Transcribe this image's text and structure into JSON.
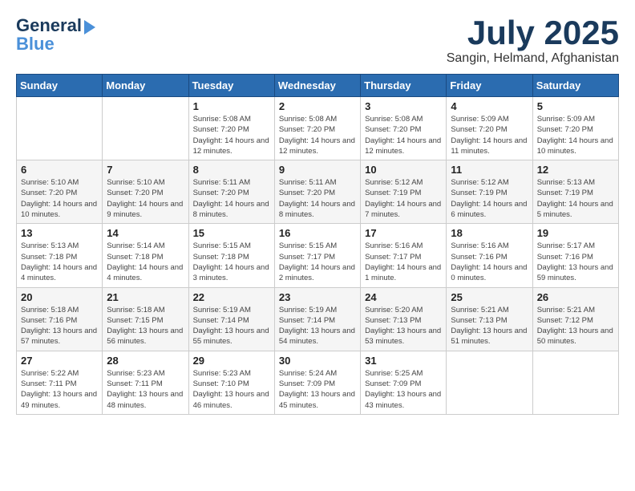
{
  "header": {
    "logo_line1": "General",
    "logo_line2": "Blue",
    "month": "July 2025",
    "location": "Sangin, Helmand, Afghanistan"
  },
  "weekdays": [
    "Sunday",
    "Monday",
    "Tuesday",
    "Wednesday",
    "Thursday",
    "Friday",
    "Saturday"
  ],
  "weeks": [
    [
      {
        "day": "",
        "info": ""
      },
      {
        "day": "",
        "info": ""
      },
      {
        "day": "1",
        "info": "Sunrise: 5:08 AM\nSunset: 7:20 PM\nDaylight: 14 hours\nand 12 minutes."
      },
      {
        "day": "2",
        "info": "Sunrise: 5:08 AM\nSunset: 7:20 PM\nDaylight: 14 hours\nand 12 minutes."
      },
      {
        "day": "3",
        "info": "Sunrise: 5:08 AM\nSunset: 7:20 PM\nDaylight: 14 hours\nand 12 minutes."
      },
      {
        "day": "4",
        "info": "Sunrise: 5:09 AM\nSunset: 7:20 PM\nDaylight: 14 hours\nand 11 minutes."
      },
      {
        "day": "5",
        "info": "Sunrise: 5:09 AM\nSunset: 7:20 PM\nDaylight: 14 hours\nand 10 minutes."
      }
    ],
    [
      {
        "day": "6",
        "info": "Sunrise: 5:10 AM\nSunset: 7:20 PM\nDaylight: 14 hours\nand 10 minutes."
      },
      {
        "day": "7",
        "info": "Sunrise: 5:10 AM\nSunset: 7:20 PM\nDaylight: 14 hours\nand 9 minutes."
      },
      {
        "day": "8",
        "info": "Sunrise: 5:11 AM\nSunset: 7:20 PM\nDaylight: 14 hours\nand 8 minutes."
      },
      {
        "day": "9",
        "info": "Sunrise: 5:11 AM\nSunset: 7:20 PM\nDaylight: 14 hours\nand 8 minutes."
      },
      {
        "day": "10",
        "info": "Sunrise: 5:12 AM\nSunset: 7:19 PM\nDaylight: 14 hours\nand 7 minutes."
      },
      {
        "day": "11",
        "info": "Sunrise: 5:12 AM\nSunset: 7:19 PM\nDaylight: 14 hours\nand 6 minutes."
      },
      {
        "day": "12",
        "info": "Sunrise: 5:13 AM\nSunset: 7:19 PM\nDaylight: 14 hours\nand 5 minutes."
      }
    ],
    [
      {
        "day": "13",
        "info": "Sunrise: 5:13 AM\nSunset: 7:18 PM\nDaylight: 14 hours\nand 4 minutes."
      },
      {
        "day": "14",
        "info": "Sunrise: 5:14 AM\nSunset: 7:18 PM\nDaylight: 14 hours\nand 4 minutes."
      },
      {
        "day": "15",
        "info": "Sunrise: 5:15 AM\nSunset: 7:18 PM\nDaylight: 14 hours\nand 3 minutes."
      },
      {
        "day": "16",
        "info": "Sunrise: 5:15 AM\nSunset: 7:17 PM\nDaylight: 14 hours\nand 2 minutes."
      },
      {
        "day": "17",
        "info": "Sunrise: 5:16 AM\nSunset: 7:17 PM\nDaylight: 14 hours\nand 1 minute."
      },
      {
        "day": "18",
        "info": "Sunrise: 5:16 AM\nSunset: 7:16 PM\nDaylight: 14 hours\nand 0 minutes."
      },
      {
        "day": "19",
        "info": "Sunrise: 5:17 AM\nSunset: 7:16 PM\nDaylight: 13 hours\nand 59 minutes."
      }
    ],
    [
      {
        "day": "20",
        "info": "Sunrise: 5:18 AM\nSunset: 7:16 PM\nDaylight: 13 hours\nand 57 minutes."
      },
      {
        "day": "21",
        "info": "Sunrise: 5:18 AM\nSunset: 7:15 PM\nDaylight: 13 hours\nand 56 minutes."
      },
      {
        "day": "22",
        "info": "Sunrise: 5:19 AM\nSunset: 7:14 PM\nDaylight: 13 hours\nand 55 minutes."
      },
      {
        "day": "23",
        "info": "Sunrise: 5:19 AM\nSunset: 7:14 PM\nDaylight: 13 hours\nand 54 minutes."
      },
      {
        "day": "24",
        "info": "Sunrise: 5:20 AM\nSunset: 7:13 PM\nDaylight: 13 hours\nand 53 minutes."
      },
      {
        "day": "25",
        "info": "Sunrise: 5:21 AM\nSunset: 7:13 PM\nDaylight: 13 hours\nand 51 minutes."
      },
      {
        "day": "26",
        "info": "Sunrise: 5:21 AM\nSunset: 7:12 PM\nDaylight: 13 hours\nand 50 minutes."
      }
    ],
    [
      {
        "day": "27",
        "info": "Sunrise: 5:22 AM\nSunset: 7:11 PM\nDaylight: 13 hours\nand 49 minutes."
      },
      {
        "day": "28",
        "info": "Sunrise: 5:23 AM\nSunset: 7:11 PM\nDaylight: 13 hours\nand 48 minutes."
      },
      {
        "day": "29",
        "info": "Sunrise: 5:23 AM\nSunset: 7:10 PM\nDaylight: 13 hours\nand 46 minutes."
      },
      {
        "day": "30",
        "info": "Sunrise: 5:24 AM\nSunset: 7:09 PM\nDaylight: 13 hours\nand 45 minutes."
      },
      {
        "day": "31",
        "info": "Sunrise: 5:25 AM\nSunset: 7:09 PM\nDaylight: 13 hours\nand 43 minutes."
      },
      {
        "day": "",
        "info": ""
      },
      {
        "day": "",
        "info": ""
      }
    ]
  ]
}
